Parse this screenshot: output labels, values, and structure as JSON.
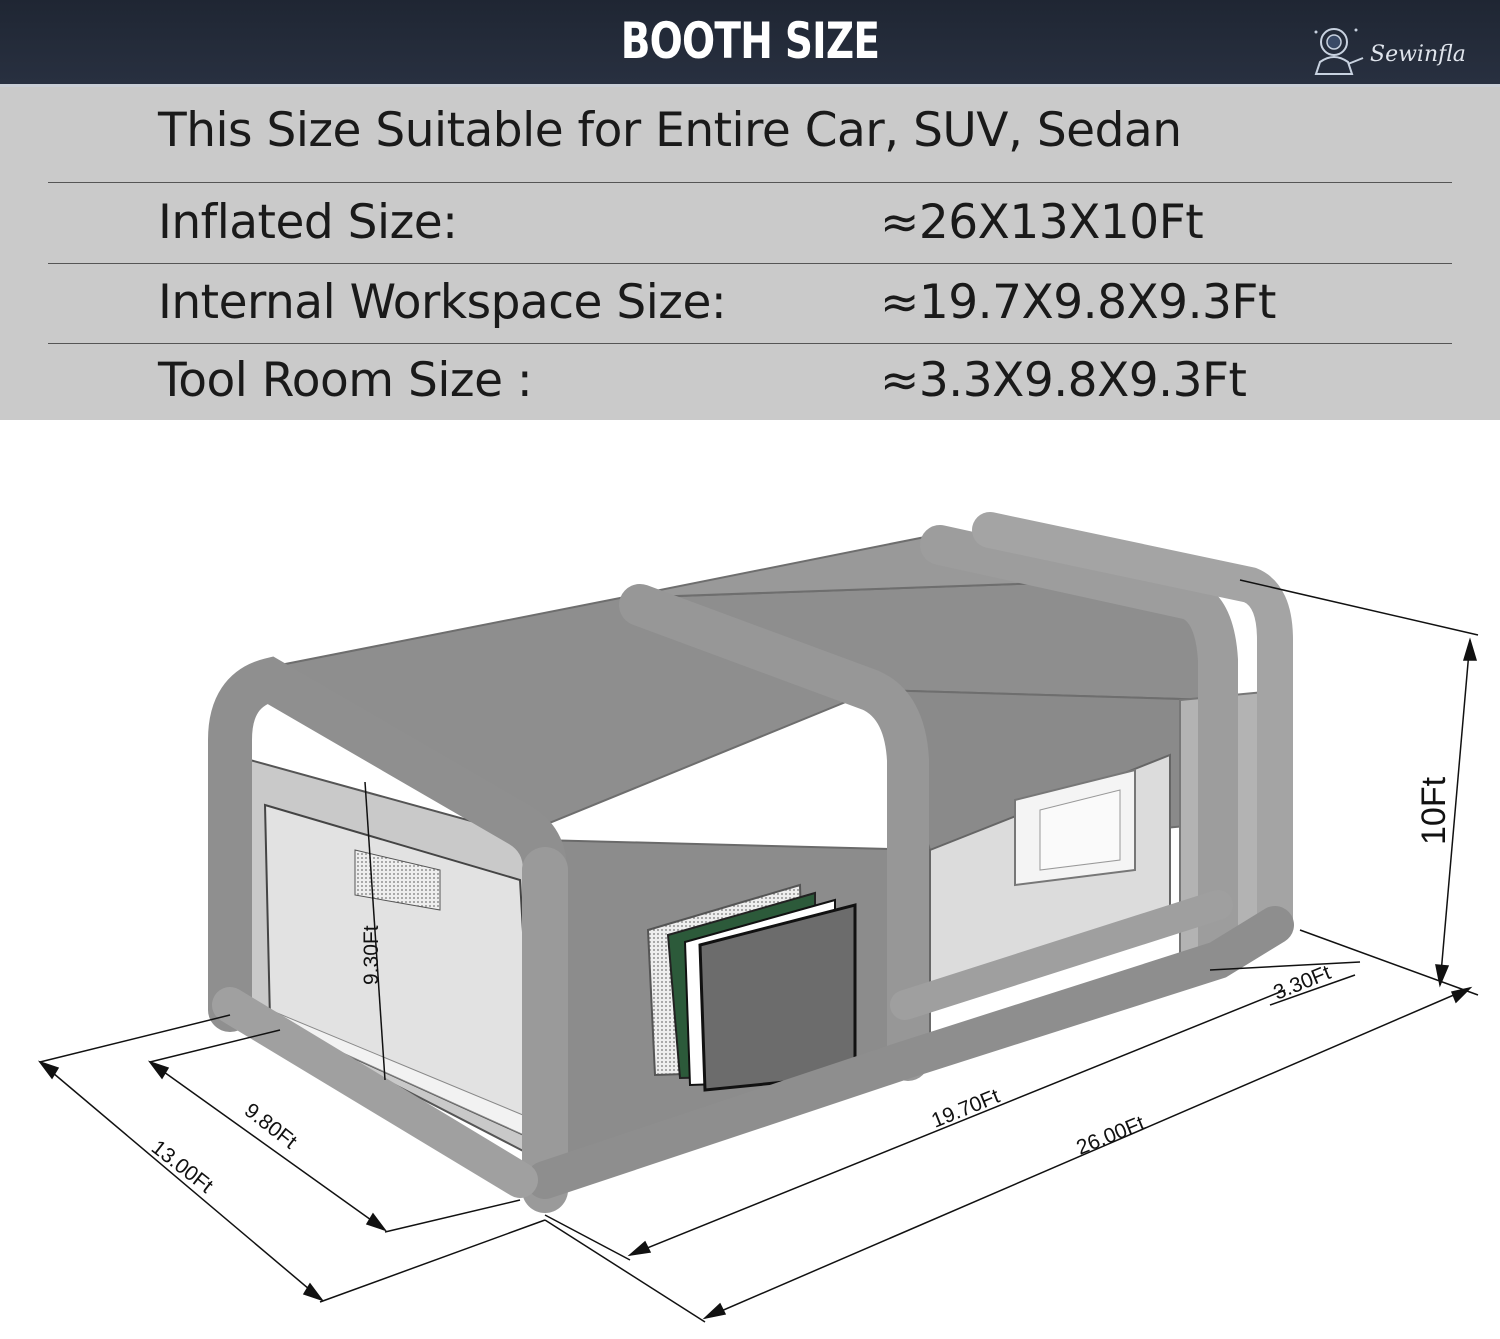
{
  "header": {
    "title": "BOOTH SIZE",
    "brand": "Sewinfla"
  },
  "specs": {
    "headline": "This Size Suitable for Entire Car, SUV, Sedan",
    "rows": [
      {
        "label": "Inflated Size:",
        "value": "≈26X13X10Ft"
      },
      {
        "label": "Internal Workspace Size:",
        "value": "≈19.7X9.8X9.3Ft"
      },
      {
        "label": "Tool Room Size :",
        "value": "≈3.3X9.8X9.3Ft"
      }
    ]
  },
  "dimensions": {
    "height": "10Ft",
    "inner_height": "9.30Ft",
    "inner_width": "9.80Ft",
    "outer_width": "13.00Ft",
    "work_length": "19.70Ft",
    "total_length": "26.00Ft",
    "tool_room": "3.30Ft"
  },
  "colors": {
    "banner": "#232a38",
    "panel": "#cacaca",
    "tent": "#9a9a9a",
    "accent_strip": "#d42020"
  }
}
